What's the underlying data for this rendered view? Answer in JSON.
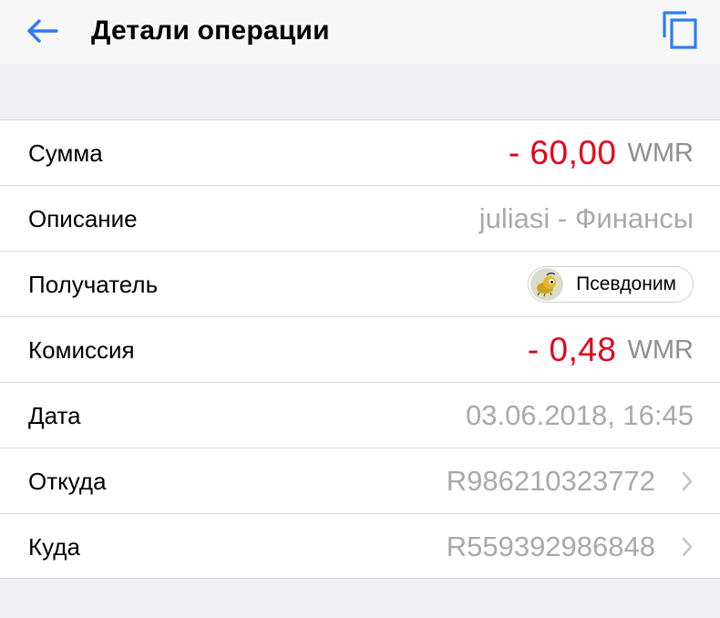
{
  "header": {
    "title": "Детали операции",
    "back_icon": "back-arrow-icon",
    "copy_icon": "copy-icon"
  },
  "details": {
    "amount": {
      "label": "Сумма",
      "value": "- 60,00",
      "currency": "WMR"
    },
    "description": {
      "label": "Описание",
      "value": "juliasi - Финансы"
    },
    "recipient": {
      "label": "Получатель",
      "chip_text": "Псевдоним",
      "avatar_icon": "webmoney-bug-avatar-icon"
    },
    "commission": {
      "label": "Комиссия",
      "value": "- 0,48",
      "currency": "WMR"
    },
    "date": {
      "label": "Дата",
      "value": "03.06.2018, 16:45"
    },
    "from": {
      "label": "Откуда",
      "value": "R986210323772"
    },
    "to": {
      "label": "Куда",
      "value": "R559392986848"
    }
  },
  "colors": {
    "accent": "#2d7cf6",
    "negative": "#e4001b",
    "secondary_text": "#a9a9ad",
    "background": "#efeff4"
  }
}
